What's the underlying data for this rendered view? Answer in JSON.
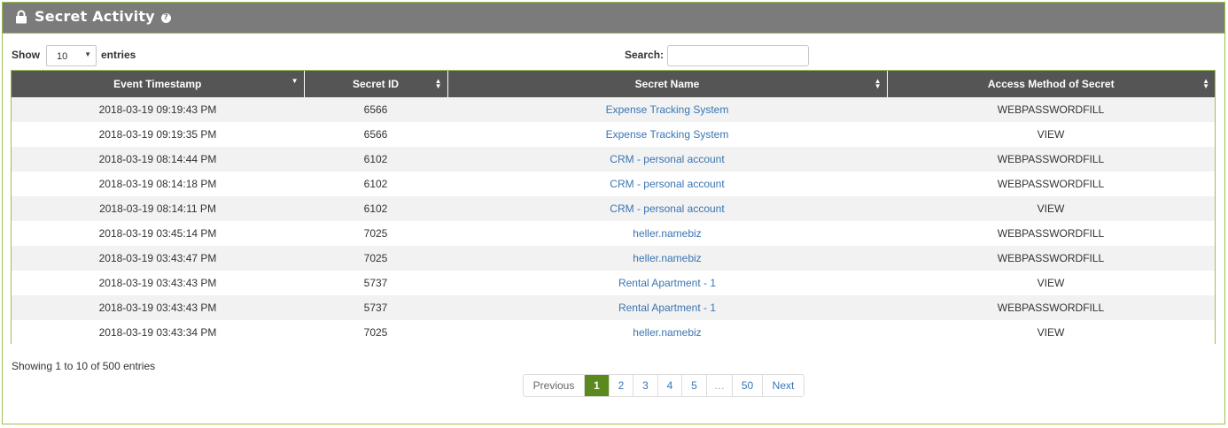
{
  "panel": {
    "title": "Secret Activity",
    "help_glyph": "?",
    "accent_color": "#9bbf50"
  },
  "length": {
    "show_label": "Show",
    "value": "10",
    "entries_label": "entries"
  },
  "search": {
    "label": "Search:",
    "value": ""
  },
  "table": {
    "columns": [
      "Event Timestamp",
      "Secret ID",
      "Secret Name",
      "Access Method of Secret"
    ],
    "rows": [
      {
        "timestamp": "2018-03-19 09:19:43 PM",
        "secret_id": "6566",
        "secret_name": "Expense Tracking System",
        "access_method": "WEBPASSWORDFILL"
      },
      {
        "timestamp": "2018-03-19 09:19:35 PM",
        "secret_id": "6566",
        "secret_name": "Expense Tracking System",
        "access_method": "VIEW"
      },
      {
        "timestamp": "2018-03-19 08:14:44 PM",
        "secret_id": "6102",
        "secret_name": "CRM - personal account",
        "access_method": "WEBPASSWORDFILL"
      },
      {
        "timestamp": "2018-03-19 08:14:18 PM",
        "secret_id": "6102",
        "secret_name": "CRM - personal account",
        "access_method": "WEBPASSWORDFILL"
      },
      {
        "timestamp": "2018-03-19 08:14:11 PM",
        "secret_id": "6102",
        "secret_name": "CRM - personal account",
        "access_method": "VIEW"
      },
      {
        "timestamp": "2018-03-19 03:45:14 PM",
        "secret_id": "7025",
        "secret_name": "heller.namebiz",
        "access_method": "WEBPASSWORDFILL"
      },
      {
        "timestamp": "2018-03-19 03:43:47 PM",
        "secret_id": "7025",
        "secret_name": "heller.namebiz",
        "access_method": "WEBPASSWORDFILL"
      },
      {
        "timestamp": "2018-03-19 03:43:43 PM",
        "secret_id": "5737",
        "secret_name": "Rental Apartment - 1",
        "access_method": "VIEW"
      },
      {
        "timestamp": "2018-03-19 03:43:43 PM",
        "secret_id": "5737",
        "secret_name": "Rental Apartment - 1",
        "access_method": "WEBPASSWORDFILL"
      },
      {
        "timestamp": "2018-03-19 03:43:34 PM",
        "secret_id": "7025",
        "secret_name": "heller.namebiz",
        "access_method": "VIEW"
      }
    ]
  },
  "info": "Showing 1 to 10 of 500 entries",
  "pagination": {
    "previous": "Previous",
    "pages": [
      "1",
      "2",
      "3",
      "4",
      "5",
      "…",
      "50"
    ],
    "active": "1",
    "next": "Next"
  }
}
